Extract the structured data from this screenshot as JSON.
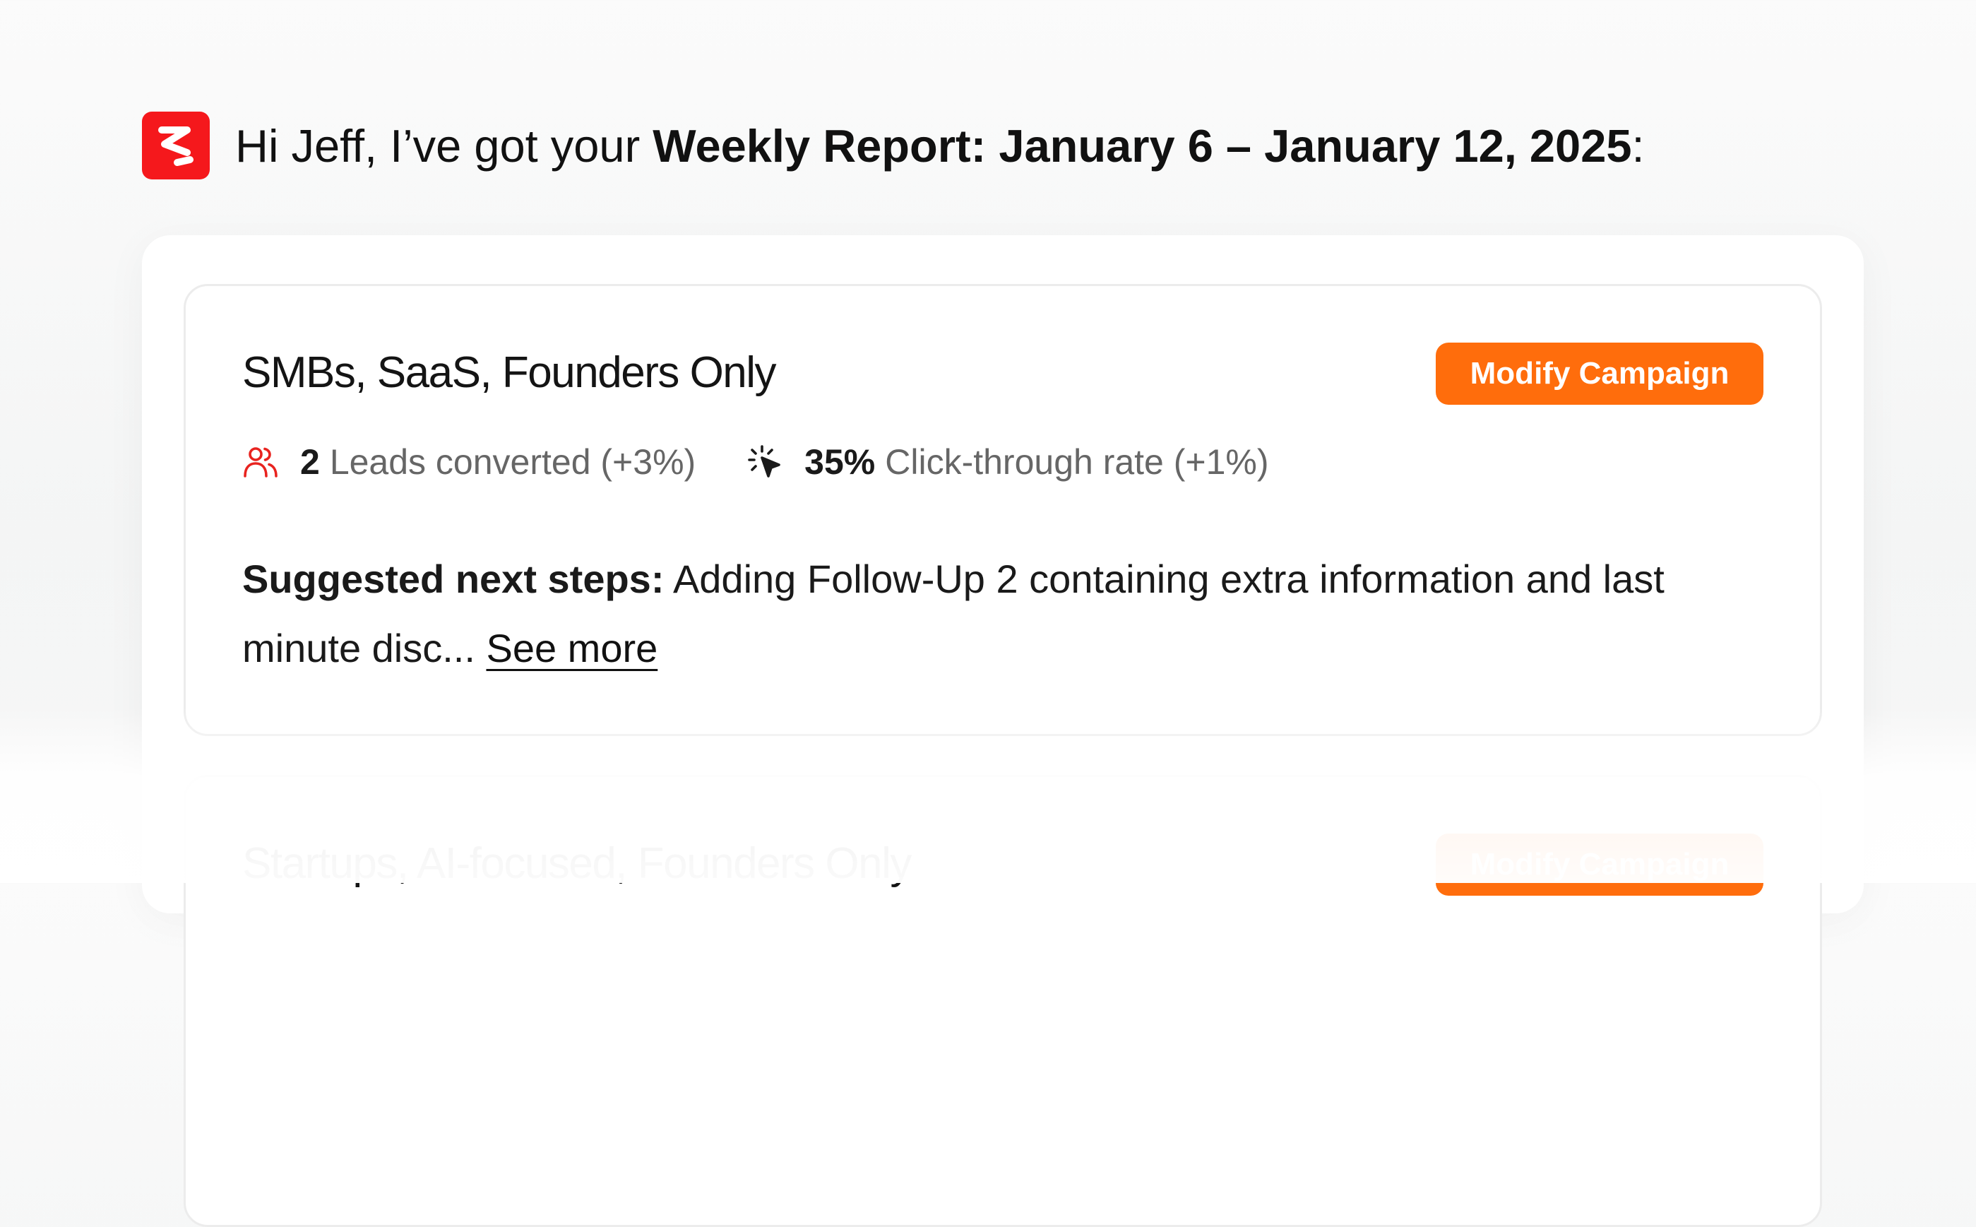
{
  "greeting": {
    "prefix": "Hi Jeff, I’ve got your ",
    "report_title": "Weekly Report: January 6 – January 12, 2025",
    "suffix": ":"
  },
  "colors": {
    "brand_red": "#f5181c",
    "accent_orange": "#ff6d0c"
  },
  "icons": {
    "logo": "brand-logo-icon",
    "leads": "users-icon",
    "clicks": "cursor-click-icon"
  },
  "campaigns": [
    {
      "title": "SMBs, SaaS, Founders Only",
      "button_label": "Modify Campaign",
      "leads_value": "2",
      "leads_text": "Leads converted (+3%)",
      "ctr_value": "35%",
      "ctr_text": "Click-through rate (+1%)",
      "next_steps_label": "Suggested next steps:",
      "next_steps_text": " Adding Follow-Up 2 containing extra information and last minute disc... ",
      "see_more": "See more"
    },
    {
      "title": "Startups, AI-focused, Founders Only",
      "button_label": "Modify Campaign"
    }
  ]
}
